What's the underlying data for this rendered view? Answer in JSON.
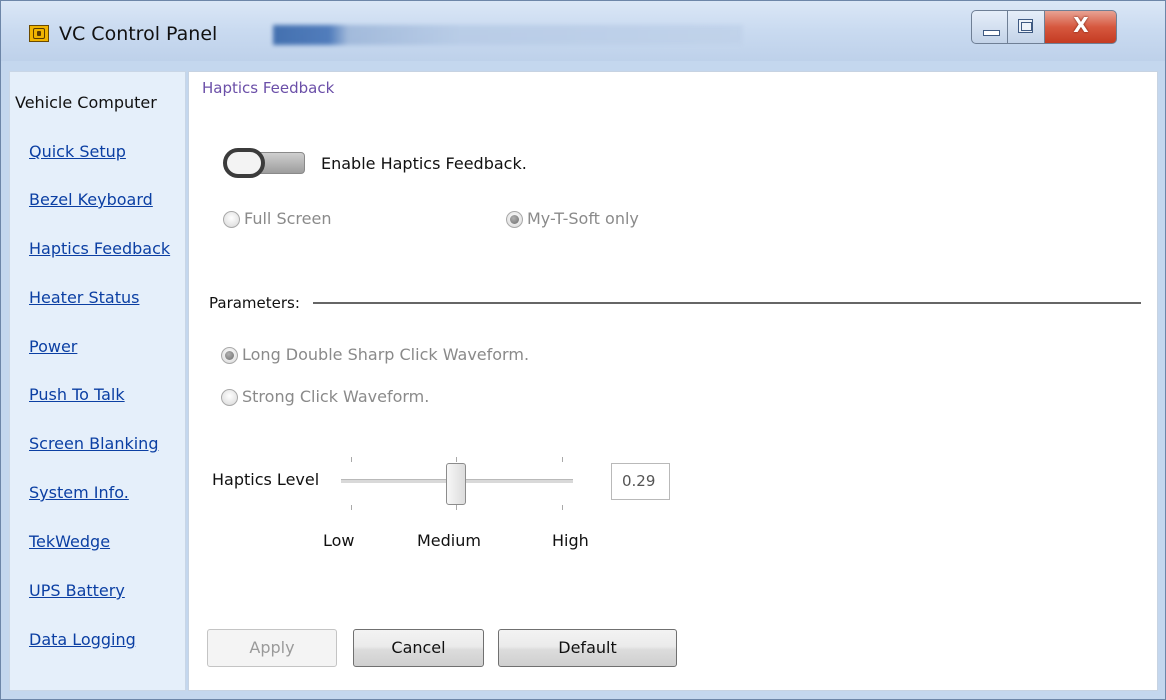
{
  "window": {
    "title": "VC Control Panel",
    "close_glyph": "X",
    "accent_colors": {
      "title_bar": "#c9daf0",
      "close_button": "#d6583f",
      "link": "#0b3fa3",
      "section_title": "#6b4fa8"
    }
  },
  "sidebar": {
    "header": "Vehicle Computer",
    "items": [
      {
        "label": "Quick Setup"
      },
      {
        "label": "Bezel Keyboard"
      },
      {
        "label": "Haptics Feedback"
      },
      {
        "label": "Heater Status"
      },
      {
        "label": "Power"
      },
      {
        "label": "Push To Talk"
      },
      {
        "label": "Screen Blanking"
      },
      {
        "label": "System Info."
      },
      {
        "label": "TekWedge"
      },
      {
        "label": "UPS Battery"
      },
      {
        "label": "Data Logging"
      }
    ]
  },
  "main": {
    "section_title": "Haptics Feedback",
    "enable_toggle": {
      "label": "Enable Haptics Feedback.",
      "state": "off"
    },
    "scope_options": [
      {
        "label": "Full Screen",
        "checked": false
      },
      {
        "label": "My-T-Soft only",
        "checked": true
      }
    ],
    "parameters_label": "Parameters:",
    "waveform_options": [
      {
        "label": "Long Double Sharp Click Waveform.",
        "checked": true
      },
      {
        "label": "Strong Click Waveform.",
        "checked": false
      }
    ],
    "haptics_level": {
      "label": "Haptics Level",
      "value": "0.29",
      "slider_position": "Medium",
      "tick_labels": [
        "Low",
        "Medium",
        "High"
      ]
    }
  },
  "buttons": {
    "apply": "Apply",
    "cancel": "Cancel",
    "default": "Default"
  }
}
